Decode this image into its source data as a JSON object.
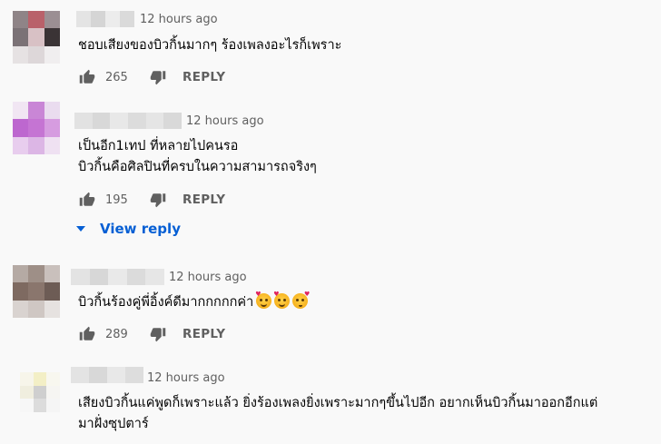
{
  "comments": [
    {
      "timestamp": "12 hours ago",
      "lines": [
        "ชอบเสียงของบิวกิ้นมากๆ ร้องเพลงอะไรก็เพราะ"
      ],
      "likes": "265",
      "reply_label": "REPLY"
    },
    {
      "timestamp": "12 hours ago",
      "lines": [
        "เป็นอีก1เทป ที่หลายไปคนรอ",
        "บิวกิ้นคือศิลปินที่ครบในความสามารถจริงๆ"
      ],
      "likes": "195",
      "reply_label": "REPLY",
      "view_reply_label": "View reply"
    },
    {
      "timestamp": "12 hours ago",
      "lines": [
        "บิวกิ้นร้องคู่พี่อิ้งค์ดีมากกกกกค่า"
      ],
      "emojis": [
        "smiling-face-with-hearts-emoji",
        "smiling-face-with-hearts-emoji",
        "face-blowing-kiss-emoji"
      ],
      "likes": "289",
      "reply_label": "REPLY"
    },
    {
      "timestamp": "12 hours ago",
      "lines": [
        "เสียงบิวกิ้นแค่พูดก็เพราะแล้ว ยิ่งร้องเพลงยิ่งเพราะมากๆขึ้นไปอีก อยากเห็นบิวกิ้นมาออกอีกแต่",
        "มาฝั่งซุปตาร์"
      ]
    }
  ],
  "icons": {
    "like": "thumbs-up-icon",
    "dislike": "thumbs-down-icon",
    "expand": "caret-down-icon"
  },
  "colors": {
    "background": "#f9f9f9",
    "text": "#030303",
    "secondary_text": "#606060",
    "link_blue": "#065fd4"
  }
}
